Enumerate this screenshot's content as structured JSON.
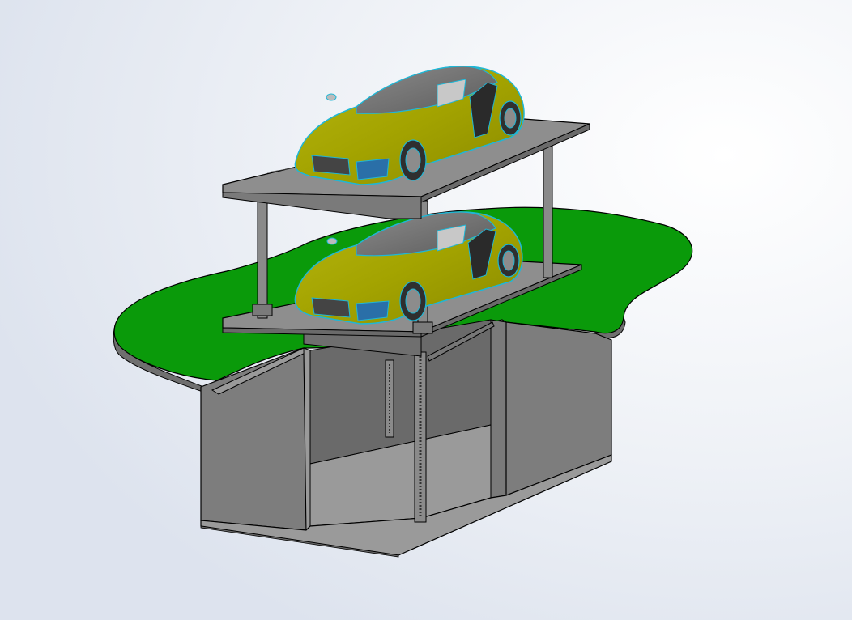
{
  "scene": {
    "subject": "parking-lift",
    "colors": {
      "background_light": "#ffffff",
      "background_tint": "#dde3ee",
      "grass": "#0a9a0a",
      "grass_edge": "#0b7f0b",
      "concrete_light": "#9a9a9a",
      "concrete_mid": "#7d7d7d",
      "concrete_dark": "#5e5e5e",
      "platform_top": "#8e8e8e",
      "platform_edge": "#6a6a6a",
      "steel": "#7a7a7a",
      "car_body": "#a8a800",
      "car_highlight": "#c9c92a",
      "car_outline": "#1fb7d6",
      "glass": "#6e6e6e",
      "tire": "#2f2f2f",
      "rim": "#8c8c8c",
      "outline": "#000000"
    }
  }
}
